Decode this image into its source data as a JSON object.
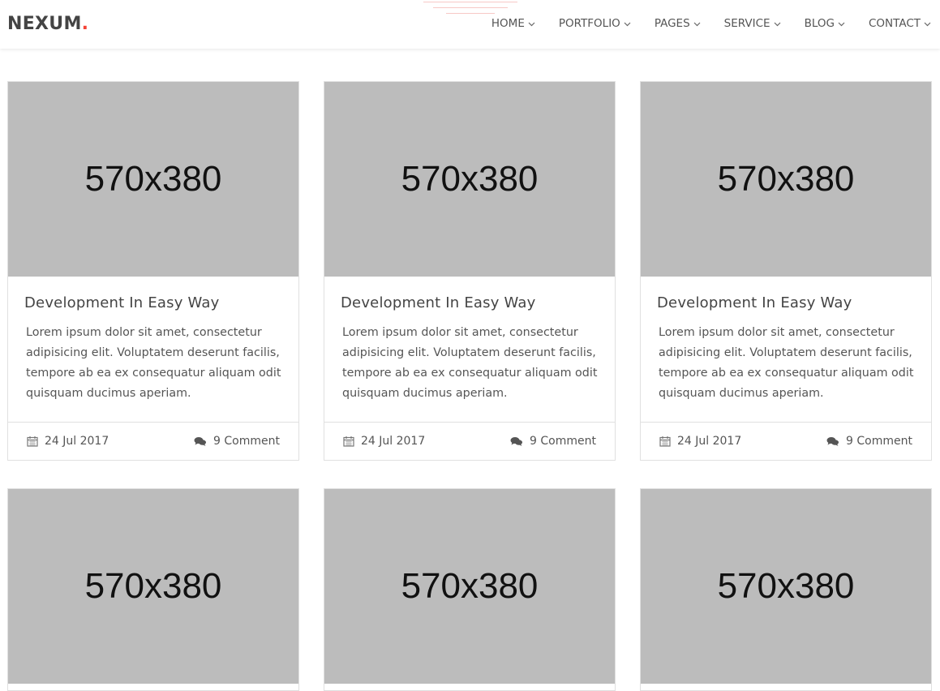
{
  "brand": {
    "name": "NEXUM",
    "dot": ".",
    "dot_color": "#f44336"
  },
  "nav": [
    {
      "label": "HOME"
    },
    {
      "label": "PORTFOLIO"
    },
    {
      "label": "PAGES"
    },
    {
      "label": "SERVICE"
    },
    {
      "label": "BLOG"
    },
    {
      "label": "CONTACT"
    }
  ],
  "posts": [
    {
      "image_label": "570x380",
      "title": "Development In Easy Way",
      "excerpt": "Lorem ipsum dolor sit amet, consectetur adipisicing elit. Voluptatem deserunt facilis, tempore ab ea ex consequatur aliquam odit quisquam ducimus aperiam.",
      "date": "24 Jul 2017",
      "comments": "9 Comment"
    },
    {
      "image_label": "570x380",
      "title": "Development In Easy Way",
      "excerpt": "Lorem ipsum dolor sit amet, consectetur adipisicing elit. Voluptatem deserunt facilis, tempore ab ea ex consequatur aliquam odit quisquam ducimus aperiam.",
      "date": "24 Jul 2017",
      "comments": "9 Comment"
    },
    {
      "image_label": "570x380",
      "title": "Development In Easy Way",
      "excerpt": "Lorem ipsum dolor sit amet, consectetur adipisicing elit. Voluptatem deserunt facilis, tempore ab ea ex consequatur aliquam odit quisquam ducimus aperiam.",
      "date": "24 Jul 2017",
      "comments": "9 Comment"
    },
    {
      "image_label": "570x380"
    },
    {
      "image_label": "570x380"
    },
    {
      "image_label": "570x380"
    }
  ],
  "icons": {
    "date": "calendar-icon",
    "comments": "comments-icon",
    "dropdown": "chevron-down-icon"
  }
}
